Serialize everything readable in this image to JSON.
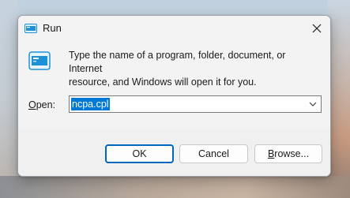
{
  "window": {
    "title": "Run",
    "icon": "run-icon",
    "close_icon": "close-icon"
  },
  "content": {
    "description_line1": "Type the name of a program, folder, document, or Internet",
    "description_line2": "resource, and Windows will open it for you.",
    "open_label_prefix": "O",
    "open_label_rest": "pen:",
    "input_value": "ncpa.cpl",
    "input_dropdown_icon": "chevron-down-icon"
  },
  "buttons": {
    "ok": "OK",
    "cancel": "Cancel",
    "browse_prefix": "B",
    "browse_rest": "rowse..."
  },
  "colors": {
    "selection": "#0078d7",
    "accent_border": "#0067c0",
    "icon_blue": "#1e90d6"
  }
}
